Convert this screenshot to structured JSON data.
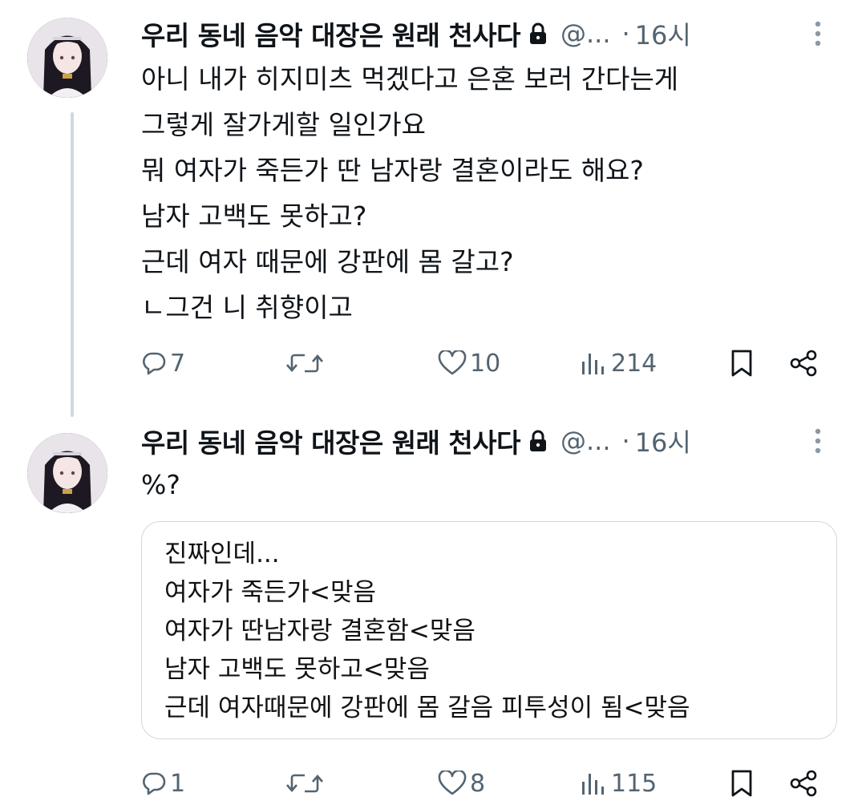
{
  "tweets": [
    {
      "author": "우리 동네 음악 대장은 원래 천사다",
      "handle": "@...",
      "dot": "·",
      "time": "16시",
      "lines": [
        "아니 내가 히지미츠 먹겠다고 은혼 보러 간다는게",
        "그렇게 잘가게할 일인가요",
        "뭐 여자가 죽든가 딴 남자랑 결혼이라도 해요?",
        "남자 고백도 못하고?",
        "근데 여자 때문에 강판에 몸 갈고?",
        "ㄴ그건 니 취향이고"
      ],
      "replies": "7",
      "likes": "10",
      "views": "214"
    },
    {
      "author": "우리 동네 음악 대장은 원래 천사다",
      "handle": "@...",
      "dot": "·",
      "time": "16시",
      "lines": [
        "%?"
      ],
      "quote_lines": [
        "진짜인데...",
        "여자가 죽든가<맞음",
        "여자가 딴남자랑 결혼함<맞음",
        "남자 고백도 못하고<맞음",
        "근데 여자때문에 강판에 몸 갈음 피투성이 됨<맞음"
      ],
      "replies": "1",
      "likes": "8",
      "views": "115"
    }
  ],
  "icons": {
    "lock": "lock-icon",
    "more": "more-vertical-icon",
    "reply": "reply-icon",
    "retweet": "retweet-icon",
    "like": "heart-icon",
    "views": "views-chart-icon",
    "bookmark": "bookmark-icon",
    "share": "share-icon"
  },
  "colors": {
    "text": "#0f1419",
    "muted": "#536471",
    "border": "#cfd9de"
  }
}
